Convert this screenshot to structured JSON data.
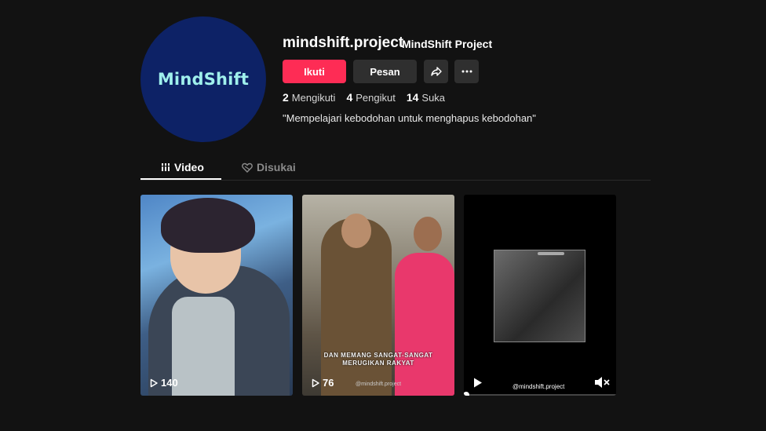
{
  "profile": {
    "avatar_text": "MindShift",
    "username": "mindshift.project",
    "nickname": "MindShift Project",
    "bio": "\"Mempelajari kebodohan untuk menghapus kebodohan\""
  },
  "actions": {
    "follow_label": "Ikuti",
    "message_label": "Pesan",
    "share_icon": "share-icon",
    "more_icon": "more-icon"
  },
  "stats": [
    {
      "count": "2",
      "label": "Mengikuti"
    },
    {
      "count": "4",
      "label": "Pengikut"
    },
    {
      "count": "14",
      "label": "Suka"
    }
  ],
  "tabs": [
    {
      "label": "Video",
      "icon": "grid-icon",
      "active": true
    },
    {
      "label": "Disukai",
      "icon": "heart-icon",
      "active": false
    }
  ],
  "videos": [
    {
      "views": "140"
    },
    {
      "views": "76",
      "caption_line1": "DAN MEMANG SANGAT-SANGAT",
      "caption_line2": "MERUGIKAN RAKYAT",
      "watermark": "@mindshift.project"
    },
    {
      "watermark": "@mindshift.project"
    }
  ],
  "colors": {
    "background": "#121212",
    "follow": "#fe2c55",
    "button_secondary": "#2f2f2f",
    "avatar_bg": "#0d2266",
    "avatar_text": "#9ff0ec"
  }
}
